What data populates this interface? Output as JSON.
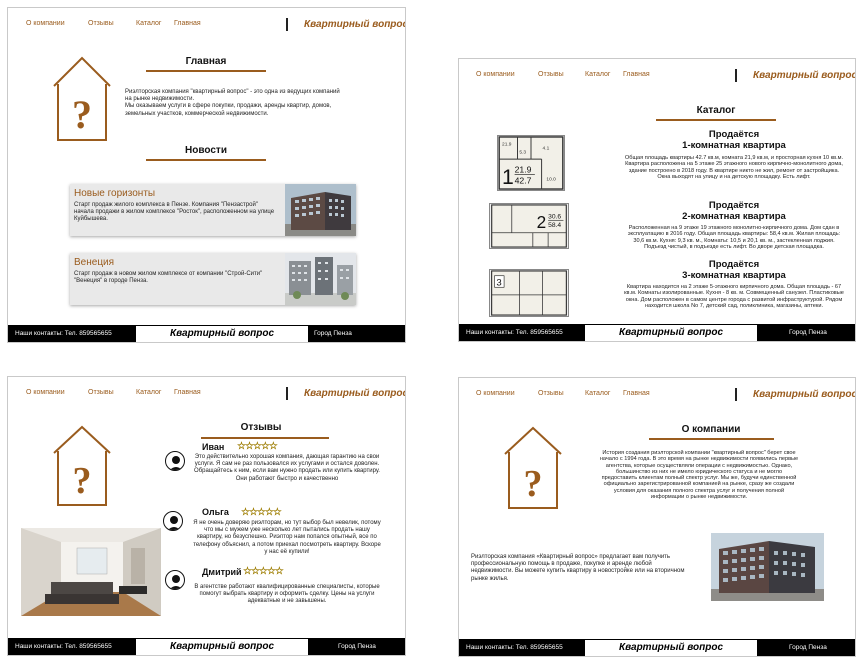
{
  "nav": {
    "about": "О компании",
    "reviews": "Отзывы",
    "catalog": "Каталог",
    "home": "Главная",
    "brand": "Квартирный вопрос"
  },
  "footer": {
    "contacts": "Наши контакты: Тел. 859565655",
    "brand": "Квартирный вопрос",
    "city": "Город Пенза"
  },
  "home_page": {
    "title": "Главная",
    "intro": "Риэлторская компания \"квартирный вопрос\" - это одна из ведущих компаний на рынке недвижимости.",
    "intro2": "Мы оказываем услуги в сфере покупки, продажи, аренды квартир, домов, земельных участков, коммерческой недвижимости.",
    "news_title": "Новости",
    "news": [
      {
        "title": "Новые горизонты",
        "text": "Старт продаж жилого комплекса в Пензе. Компания \"Пензастрой\" начала продажи в жилом комплексе \"Росток\", расположенном на улице Куйбышева."
      },
      {
        "title": "Венеция",
        "text": "Старт продаж в новом жилом комплексе от компании \"Строй-Сити\" \"Венеция\" в городе Пенза."
      }
    ]
  },
  "catalog_page": {
    "title": "Каталог",
    "items": [
      {
        "head1": "Продаётся",
        "head2": "1-комнатная квартира",
        "text": "Общая площадь квартиры 42.7 кв.м, комната 21,9 кв.м, и просторная кухня 10 кв.м. Квартира расположена на 5 этаже 25 этажного нового кирпично-монолитного дома, здание построено в 2018 году. В квартире никто не жил, ремонт от застройщика. Окна выходят на улицу и на детскую площадку. Есть лифт."
      },
      {
        "head1": "Продаётся",
        "head2": "2-комнатная квартира",
        "text": "Расположенная на 9 этаже 19 этажного монолитно-кирпичного дома. Дом сдан в эксплуатацию в 2016 году. Общая площадь квартиры: 58,4 кв.м. Жилая площадь: 30,6 кв.м. Кухня: 9,3 кв. м., Комнаты: 10,5 и 20,1 кв. м., застекленная лоджия. Подъезд чистый, в подъезде есть лифт. Во дворе детская площадка."
      },
      {
        "head1": "Продаётся",
        "head2": "3-комнатная квартира",
        "text": "Квартира находится на 2 этаже 5-этажного кирпичного дома. Общая площадь - 67 кв.м. Комнаты изолированные. Кухня - 8 кв. м. Совмещенный санузел. Пластиковые окна. Дом расположен в самом центре города с развитой инфраструктурой. Рядом находится школа No 7, детский сад, поликлиника, магазины, аптеки."
      }
    ],
    "plan1": {
      "big": "1",
      "a": "21.9",
      "b": "42.7",
      "small": "21.9",
      "r1": "5.3",
      "r2": "4.1",
      "kitchen": "10.0"
    },
    "plan2": {
      "big": "2",
      "a": "30.6",
      "b": "58.4"
    },
    "plan3": {
      "big": "3"
    }
  },
  "reviews_page": {
    "title": "Отзывы",
    "stars": "☆☆☆☆☆",
    "reviews": [
      {
        "name": "Иван",
        "text": "Это действительно хорошая компания, дающая гарантию на свои услуги. Я сам не раз пользовался их услугами и остался доволен. Обращайтесь к ним, если вам нужно продать или купить квартиру. Они работают быстро и качественно"
      },
      {
        "name": "Ольга",
        "text": "Я не очень доверяю риэлторам, но тут выбор был невелик, потому что мы с мужем уже несколько лет пытались продать нашу квартиру, но безуспешно. Риэлтор нам попался опытный, все по телефону объяснил, а потом приехал посмотреть квартиру. Вскоре у нас её купили!"
      },
      {
        "name": "Дмитрий",
        "text": "В агентстве работают квалифицированные специалисты, которые помогут выбрать квартиру и оформить сделку. Цены на услуги адекватные и не завышены."
      }
    ]
  },
  "about_page": {
    "title": "О компании",
    "text": "История создания риэлторской компании \"квартирный вопрос\" берет свое начало с 1994 года. В это время на рынке недвижимости появились первые агентства, которые осуществляли операции с недвижимостью. Однако, большинство из них не имело юридического статуса и не могло предоставить клиентам полный спектр услуг. Мы же, будучи единственной официально зарегистрированной компанией на рынке, сразу же создали условия для оказания полного спектра услуг и получения полной информации о рынке недвижимости.",
    "text2": "Риэлторская компания «Квартирный вопрос» предлагает вам получить профессиональную помощь в продаже, покупке и аренде любой недвижимости. Вы можете купить квартиру в новостройке или на вторичном рынке жилья."
  },
  "colors": {
    "accent": "#9a5c1e",
    "footer": "#000000",
    "stars": "#f2c40f"
  },
  "icons": [
    "house-question-icon",
    "user-avatar-icon",
    "star-icon"
  ]
}
